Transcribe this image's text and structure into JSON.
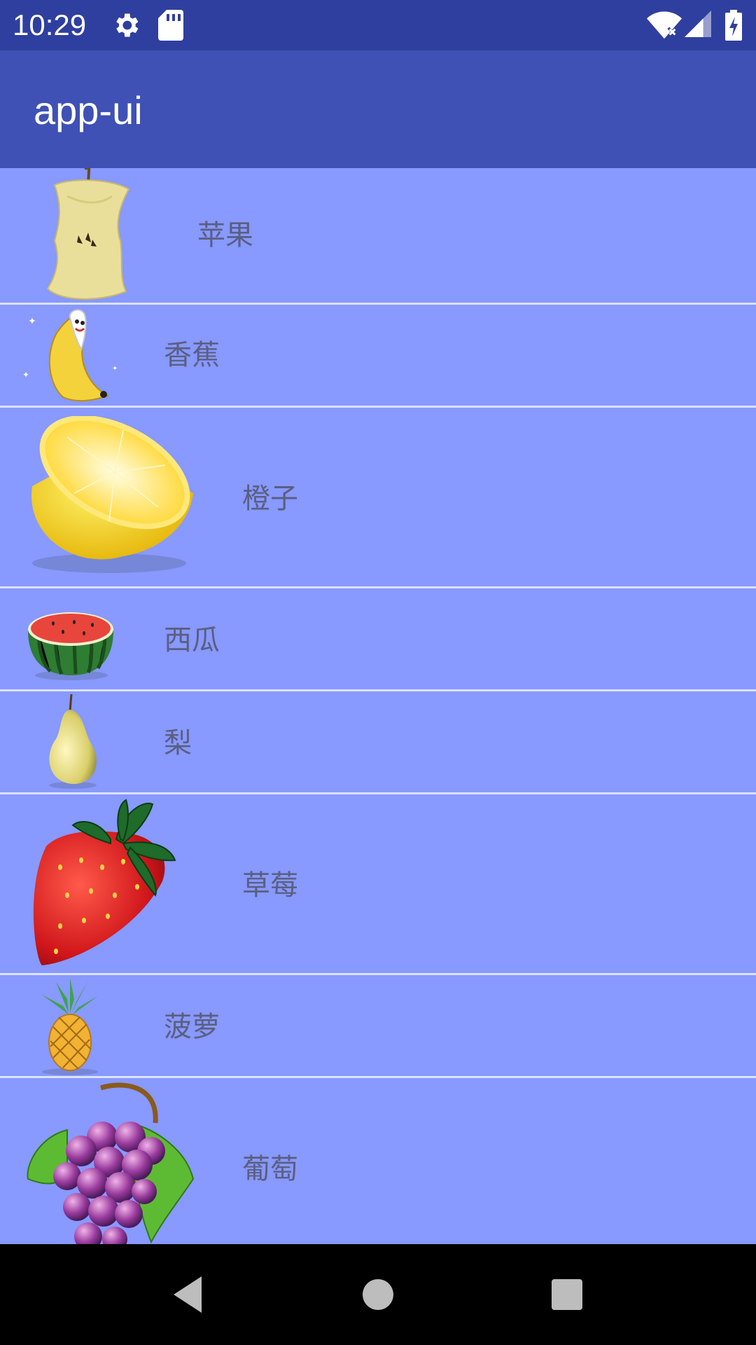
{
  "status_bar": {
    "time": "10:29",
    "icons": [
      "gear-icon",
      "sd-card-icon",
      "wifi-icon",
      "signal-icon",
      "battery-charging-icon"
    ]
  },
  "app_bar": {
    "title": "app-ui"
  },
  "fruits": [
    {
      "name": "苹果",
      "icon": "apple-core-icon"
    },
    {
      "name": "香蕉",
      "icon": "banana-icon"
    },
    {
      "name": "橙子",
      "icon": "lemon-half-icon"
    },
    {
      "name": "西瓜",
      "icon": "watermelon-icon"
    },
    {
      "name": "梨",
      "icon": "pear-icon"
    },
    {
      "name": "草莓",
      "icon": "strawberry-icon"
    },
    {
      "name": "菠萝",
      "icon": "pineapple-icon"
    },
    {
      "name": "葡萄",
      "icon": "grapes-icon"
    }
  ],
  "nav_bar": {
    "buttons": [
      "back-icon",
      "home-icon",
      "recents-icon"
    ]
  },
  "colors": {
    "status_bar": "#2F3F9F",
    "app_bar": "#3F51B5",
    "list_bg": "#8899FF",
    "divider": "#DDE2FF",
    "label_text": "#5A5F82"
  }
}
